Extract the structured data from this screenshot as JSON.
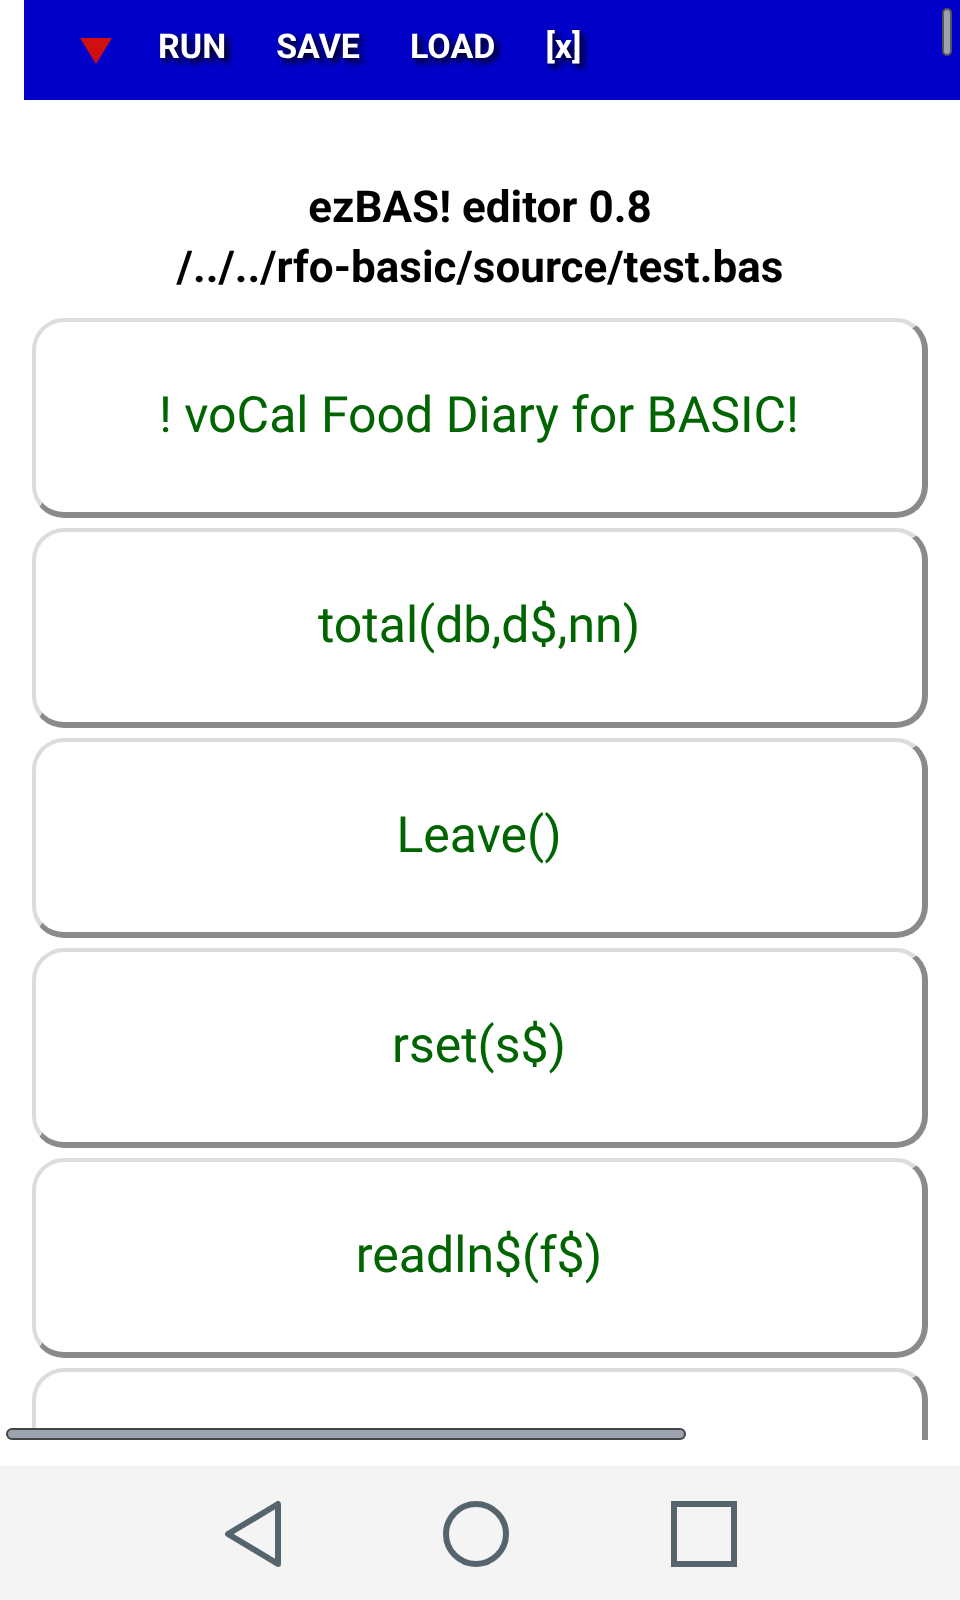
{
  "toolbar": {
    "buttons": [
      {
        "label": "RUN"
      },
      {
        "label": "SAVE"
      },
      {
        "label": "LOAD"
      },
      {
        "label": "[x]"
      }
    ]
  },
  "header": {
    "title": "ezBAS! editor 0.8",
    "path": "/../../rfo-basic/source/test.bas"
  },
  "lines": [
    {
      "text": "! voCal Food Diary for BASIC!"
    },
    {
      "text": "total(db,d$,nn)"
    },
    {
      "text": "Leave()"
    },
    {
      "text": "rset(s$)"
    },
    {
      "text": "readln$(f$)"
    }
  ]
}
